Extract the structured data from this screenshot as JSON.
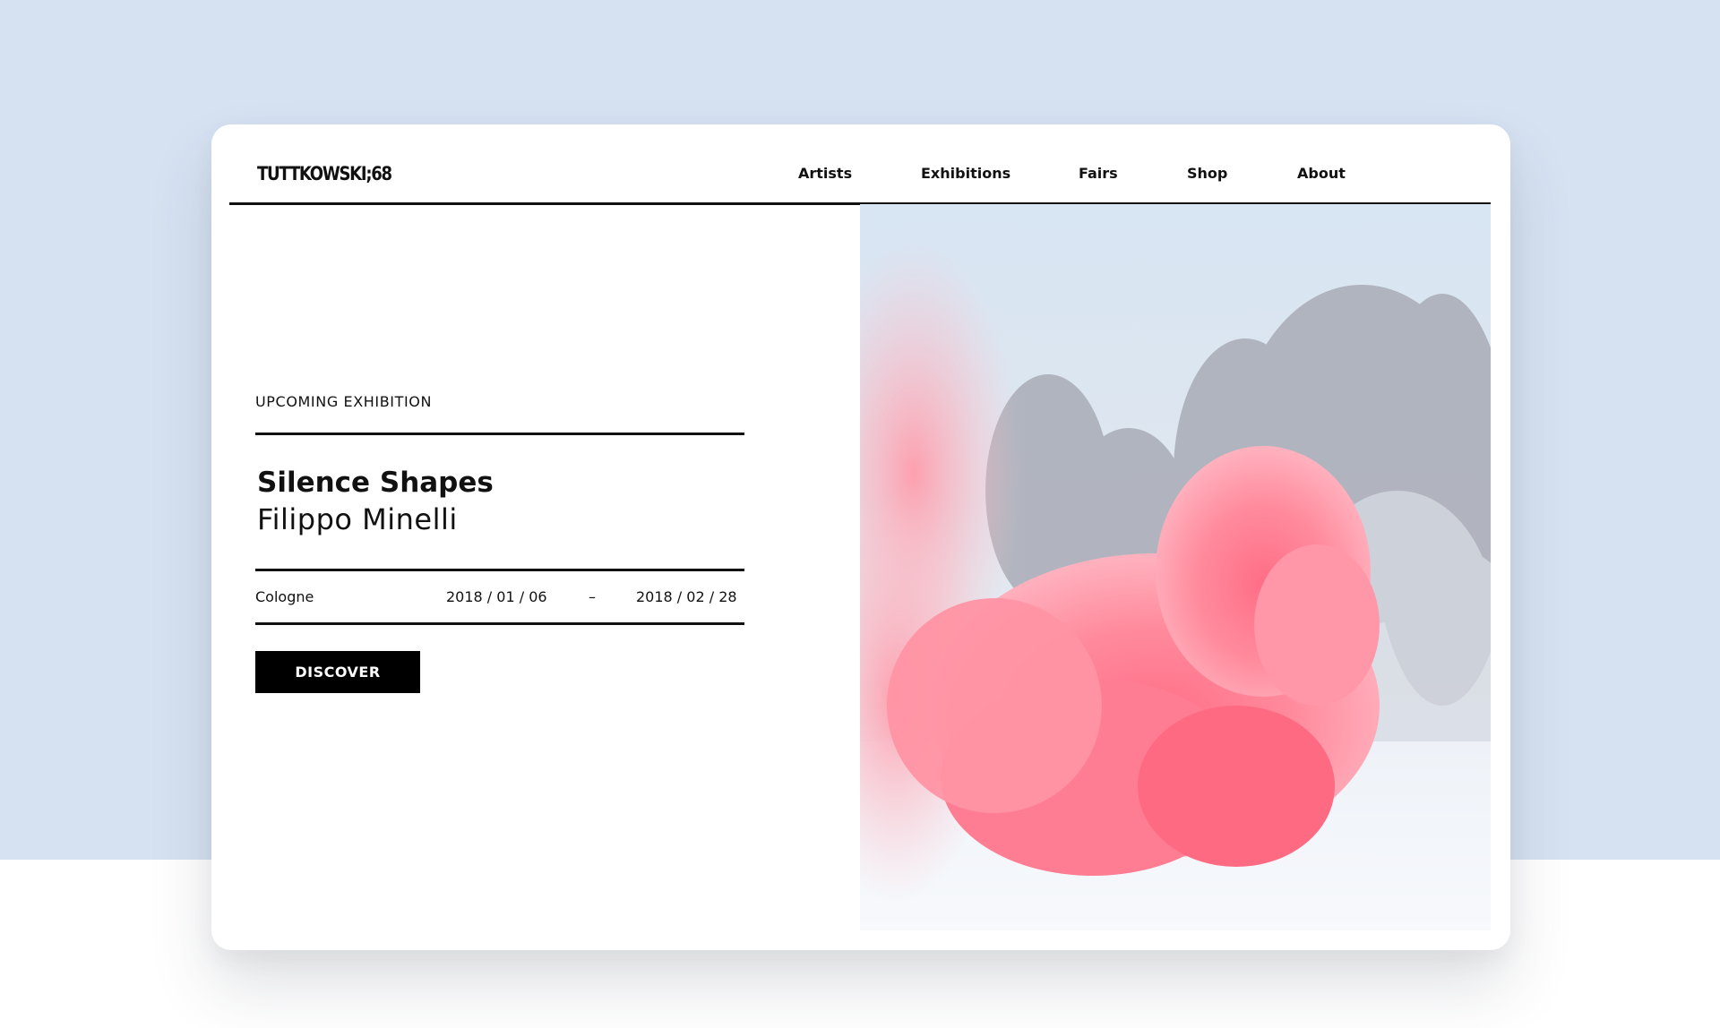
{
  "window": {
    "title": "TUTTKOWSKI;68"
  },
  "header": {
    "logo_text": "TUTTKOWSKI;68",
    "nav": [
      {
        "label": "Artists"
      },
      {
        "label": "Exhibitions"
      },
      {
        "label": "Fairs"
      },
      {
        "label": "Shop"
      },
      {
        "label": "About"
      }
    ]
  },
  "exhibition": {
    "eyebrow": "UPCOMING EXHIBITION",
    "title": "Silence Shapes",
    "artist": "Filippo Minelli",
    "city": "Cologne",
    "date_start": "2018 / 01 / 06",
    "date_separator": "–",
    "date_end": "2018 / 02 / 28",
    "cta_label": "DISCOVER"
  },
  "hero_image": {
    "subject": "pink smoke cloud in snowy forest",
    "icon": "photo"
  },
  "colors": {
    "page_background": "#d6e2f2",
    "text": "#111111",
    "button_background": "#000000",
    "button_text": "#ffffff",
    "smoke": "#f77b8f"
  }
}
